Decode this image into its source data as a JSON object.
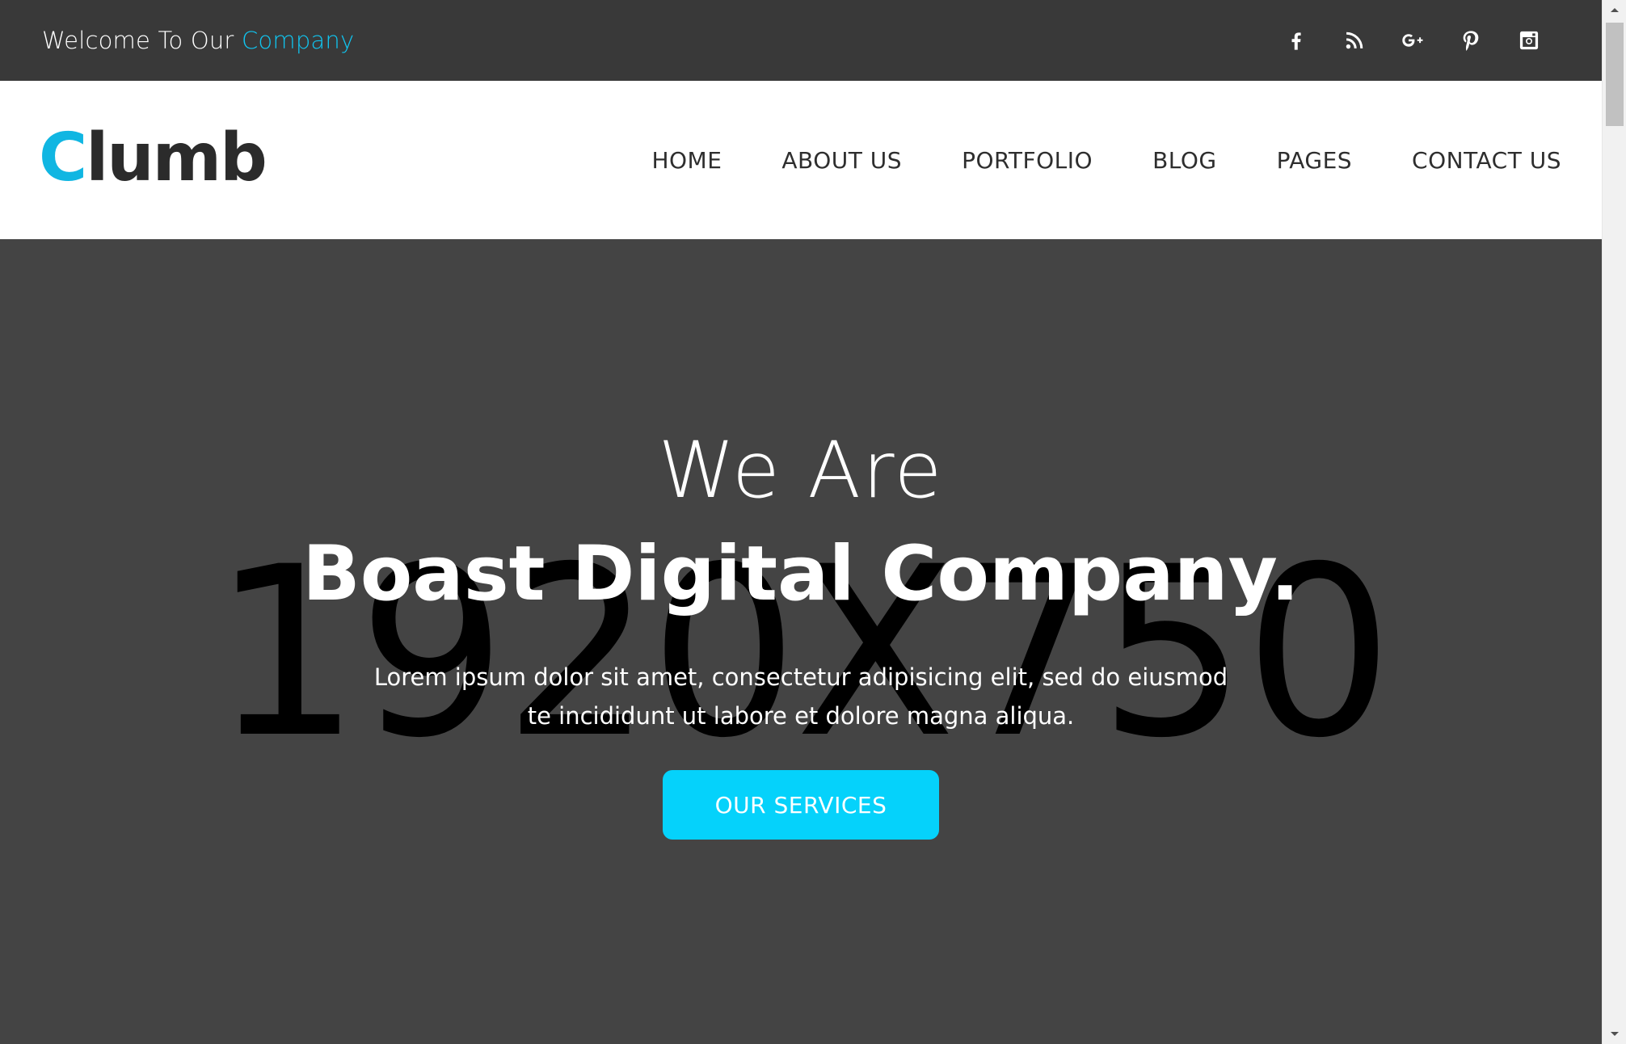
{
  "topbar": {
    "welcome_prefix": "Welcome To Our",
    "welcome_accent": "Company",
    "social": [
      {
        "icon": "facebook-icon"
      },
      {
        "icon": "rss-icon"
      },
      {
        "icon": "google-plus-icon"
      },
      {
        "icon": "pinterest-icon"
      },
      {
        "icon": "instagram-icon"
      }
    ]
  },
  "header": {
    "logo_first": "C",
    "logo_rest": "lumb",
    "nav": [
      {
        "label": "HOME"
      },
      {
        "label": "ABOUT US"
      },
      {
        "label": "PORTFOLIO"
      },
      {
        "label": "BLOG"
      },
      {
        "label": "PAGES"
      },
      {
        "label": "CONTACT US"
      }
    ]
  },
  "hero": {
    "placeholder": "1920X750",
    "title_light": "We Are",
    "title_bold": "Boast Digital Company.",
    "desc_line1": "Lorem ipsum dolor sit amet, consectetur adipisicing elit, sed do eiusmod",
    "desc_line2": "te incididunt ut labore et dolore magna aliqua.",
    "cta_label": "OUR SERVICES"
  },
  "colors": {
    "accent": "#10c5f0",
    "button": "#05d2fb",
    "topbar_bg": "#393939",
    "hero_bg": "#444444"
  }
}
